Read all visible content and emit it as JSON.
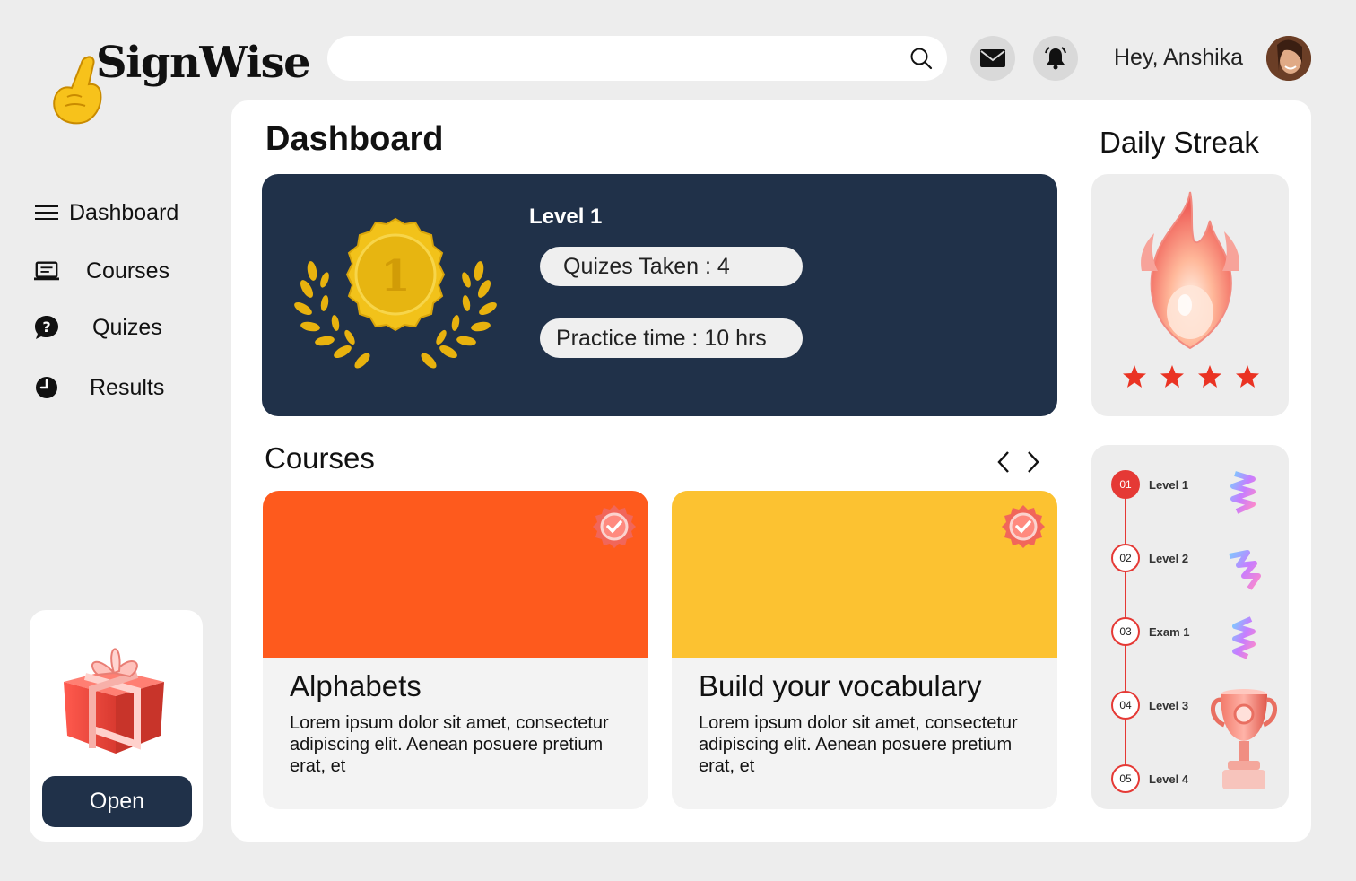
{
  "app": {
    "logo_text": "SignWise"
  },
  "header": {
    "search_placeholder": "",
    "greeting": "Hey, Anshika"
  },
  "sidebar": {
    "items": [
      {
        "label": "Dashboard",
        "icon": "menu-icon"
      },
      {
        "label": "Courses",
        "icon": "laptop-icon"
      },
      {
        "label": "Quizes",
        "icon": "question-bubble-icon"
      },
      {
        "label": "Results",
        "icon": "clock-icon"
      }
    ],
    "gift": {
      "button_label": "Open"
    }
  },
  "main": {
    "title": "Dashboard",
    "level": {
      "medal_number": "1",
      "title": "Level 1",
      "quizzes_taken": "Quizes Taken : 4",
      "practice_time": "Practice time : 10 hrs"
    },
    "courses": {
      "title": "Courses",
      "items": [
        {
          "name": "Alphabets",
          "description": "Lorem ipsum dolor sit amet, consectetur adipiscing elit. Aenean posuere pretium erat, et",
          "color": "#fe5a1d"
        },
        {
          "name": "Build your vocabulary",
          "description": "Lorem ipsum dolor sit amet, consectetur adipiscing elit. Aenean posuere pretium erat, et",
          "color": "#fcc231"
        }
      ]
    },
    "streak": {
      "title": "Daily Streak",
      "stars": 4
    },
    "levels": [
      {
        "num": "01",
        "label": "Level 1",
        "active": true
      },
      {
        "num": "02",
        "label": "Level 2",
        "active": false
      },
      {
        "num": "03",
        "label": "Exam 1",
        "active": false
      },
      {
        "num": "04",
        "label": "Level 3",
        "active": false
      },
      {
        "num": "05",
        "label": "Level 4",
        "active": false
      }
    ]
  },
  "colors": {
    "navy": "#203149",
    "orange": "#fe5a1d",
    "yellow": "#fcc231",
    "accent_red": "#e53935",
    "background": "#ededed"
  }
}
